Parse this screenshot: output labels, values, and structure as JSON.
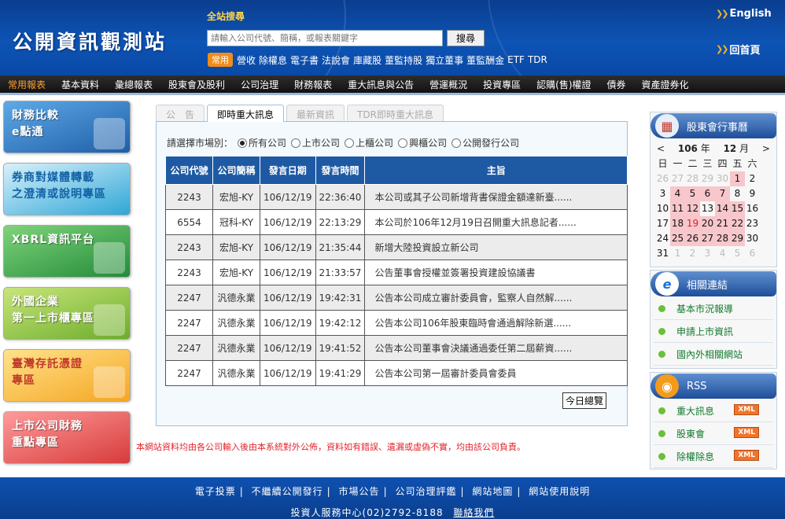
{
  "header": {
    "site_name": "公開資訊觀測站",
    "search_title": "全站搜尋",
    "search_placeholder": "請輸入公司代號、簡稱，或報表關鍵字",
    "search_button": "搜尋",
    "quick_badge": "常用",
    "quick_links": [
      "營收",
      "除權息",
      "電子書",
      "法說會",
      "庫藏股",
      "董監持股",
      "獨立董事",
      "董監酬金",
      "ETF",
      "TDR"
    ],
    "english_link": "English",
    "home_link": "回首頁"
  },
  "nav": [
    "常用報表",
    "基本資料",
    "彙總報表",
    "股東會及股利",
    "公司治理",
    "財務報表",
    "重大訊息與公告",
    "營運概況",
    "投資專區",
    "認購(售)權證",
    "債券",
    "資產證券化"
  ],
  "promos": [
    {
      "line1": "財務比較",
      "line2": "e點通"
    },
    {
      "line1": "券商對媒體轉載",
      "line2": "之澄清或說明專區"
    },
    {
      "line1": "XBRL資訊平台",
      "line2": ""
    },
    {
      "line1": "外國企業",
      "line2": "第一上市櫃專區"
    },
    {
      "line1": "臺灣存託憑證",
      "line2": "專區"
    },
    {
      "line1": "上市公司財務",
      "line2": "重點專區"
    }
  ],
  "tabs": [
    "公　告",
    "即時重大訊息",
    "最新資訊",
    "TDR即時重大訊息"
  ],
  "market_filter": {
    "label": "請選擇市場別：",
    "options": [
      "所有公司",
      "上市公司",
      "上櫃公司",
      "興櫃公司",
      "公開發行公司"
    ]
  },
  "table": {
    "headers": [
      "公司代號",
      "公司簡稱",
      "發言日期",
      "發言時間",
      "主旨"
    ],
    "rows": [
      [
        "2243",
        "宏旭-KY",
        "106/12/19",
        "22:36:40",
        "本公司或其子公司新增背書保證金額達新臺......"
      ],
      [
        "6554",
        "冠科-KY",
        "106/12/19",
        "22:13:29",
        "本公司於106年12月19日召開重大訊息記者......"
      ],
      [
        "2243",
        "宏旭-KY",
        "106/12/19",
        "21:35:44",
        "新增大陸投資設立新公司"
      ],
      [
        "2243",
        "宏旭-KY",
        "106/12/19",
        "21:33:57",
        "公告董事會授權並簽署投資建設協議書"
      ],
      [
        "2247",
        "汎德永業",
        "106/12/19",
        "19:42:31",
        "公告本公司成立審計委員會，監察人自然解......"
      ],
      [
        "2247",
        "汎德永業",
        "106/12/19",
        "19:42:12",
        "公告本公司106年股東臨時會通過解除新選......"
      ],
      [
        "2247",
        "汎德永業",
        "106/12/19",
        "19:41:52",
        "公告本公司董事會決議通過委任第二屆薪資......"
      ],
      [
        "2247",
        "汎德永業",
        "106/12/19",
        "19:41:29",
        "公告本公司第一屆審計委員會委員"
      ]
    ],
    "today_button": "今日總覽"
  },
  "disclaimer": "本網站資料均由各公司輸入後由本系統對外公佈，資料如有錯誤、遺漏或虛偽不實，均由該公司負責。",
  "calendar": {
    "title": "股東會行事曆",
    "year_prev": "<",
    "year": "106",
    "year_label": "年",
    "month": "12",
    "month_label": "月",
    "month_next": ">",
    "weekdays": [
      "日",
      "一",
      "二",
      "三",
      "四",
      "五",
      "六"
    ]
  },
  "related": {
    "title": "相關連結",
    "items": [
      "基本市況報導",
      "申請上市資訊",
      "國內外相關網站"
    ]
  },
  "rss": {
    "title": "RSS",
    "items": [
      "重大訊息",
      "股東會",
      "除權除息"
    ],
    "badge": "XML"
  },
  "footer": {
    "links": [
      "電子投票",
      "不繼續公開發行",
      "市場公告",
      "公司治理評鑑",
      "網站地圖",
      "網站使用說明"
    ],
    "service": "投資人服務中心(02)2792-8188",
    "contact": "聯絡我們"
  },
  "colors": {
    "header_blue": "#0d54b5",
    "nav_active": "#ff9f2d",
    "table_header": "#1e5aa3",
    "disclaimer_red": "#e3252c"
  }
}
